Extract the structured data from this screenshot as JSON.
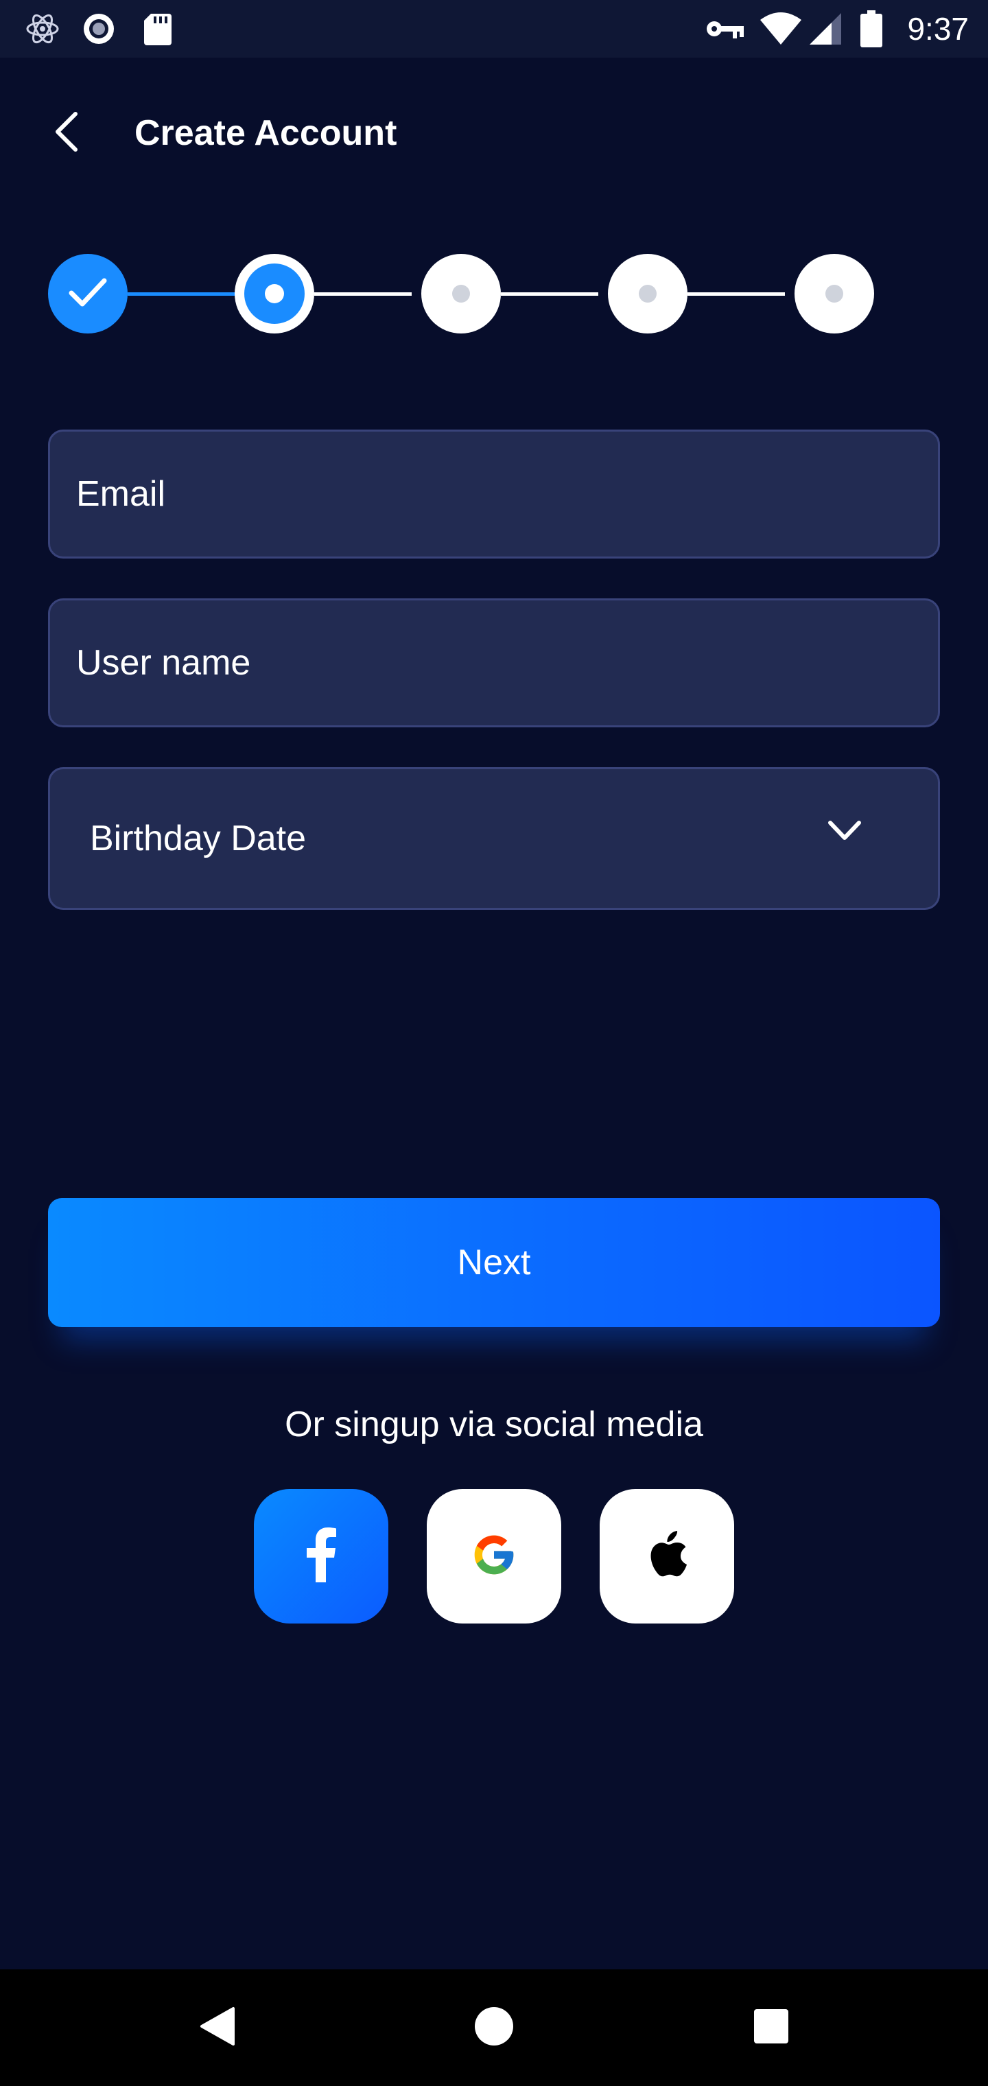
{
  "status_bar": {
    "time": "9:37",
    "icons": [
      "atom-icon",
      "record-icon",
      "sd-card-icon",
      "key-icon",
      "wifi-icon",
      "signal-icon",
      "battery-icon"
    ]
  },
  "header": {
    "title": "Create Account",
    "back_icon": "chevron-left-icon"
  },
  "stepper": {
    "total_steps": 5,
    "completed_steps": 1,
    "current_step": 2
  },
  "form": {
    "email_placeholder": "Email",
    "username_placeholder": "User name",
    "birthday_label": "Birthday Date",
    "birthday_icon": "chevron-down-icon"
  },
  "actions": {
    "next_label": "Next",
    "social_caption": "Or singup via social media"
  },
  "social": [
    {
      "name": "facebook",
      "icon": "facebook-icon"
    },
    {
      "name": "google",
      "icon": "google-icon"
    },
    {
      "name": "apple",
      "icon": "apple-icon"
    }
  ],
  "colors": {
    "background": "#070d2b",
    "status_bar": "#0f1735",
    "field": "#222b52",
    "field_border": "#39437a",
    "accent": "#1a8cff",
    "button_gradient_start": "#0a8aff",
    "button_gradient_end": "#0b55ff"
  },
  "nav_bar": {
    "icons": [
      "back-triangle-icon",
      "home-circle-icon",
      "recents-square-icon"
    ]
  }
}
